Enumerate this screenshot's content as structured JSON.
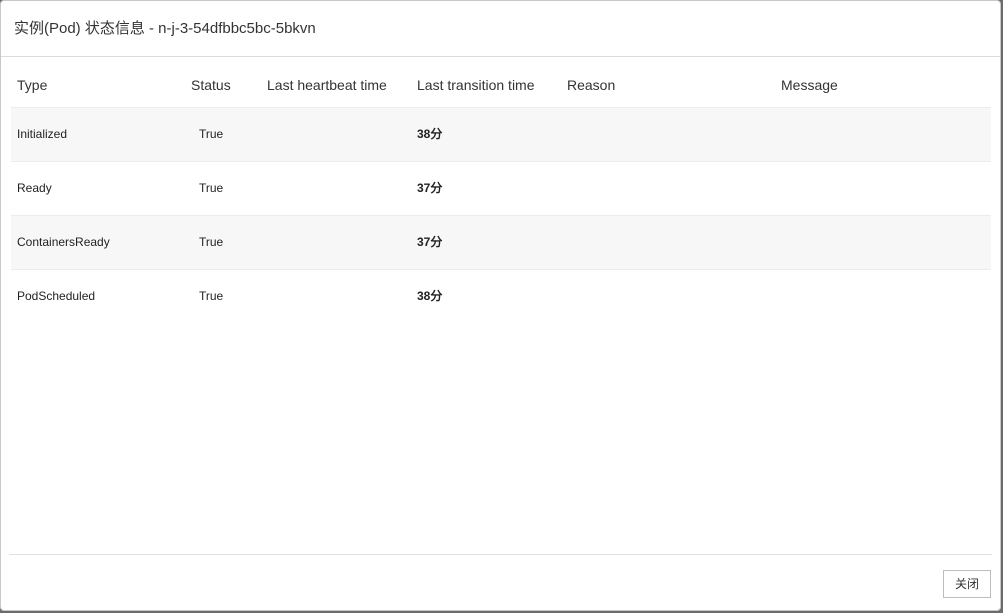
{
  "modal": {
    "title": "实例(Pod) 状态信息 - n-j-3-54dfbbc5bc-5bkvn",
    "close_label": "关闭"
  },
  "table": {
    "headers": {
      "type": "Type",
      "status": "Status",
      "last_heartbeat": "Last heartbeat time",
      "last_transition": "Last transition time",
      "reason": "Reason",
      "message": "Message"
    },
    "rows": [
      {
        "type": "Initialized",
        "status": "True",
        "last_heartbeat": "",
        "last_transition": "38分",
        "reason": "",
        "message": ""
      },
      {
        "type": "Ready",
        "status": "True",
        "last_heartbeat": "",
        "last_transition": "37分",
        "reason": "",
        "message": ""
      },
      {
        "type": "ContainersReady",
        "status": "True",
        "last_heartbeat": "",
        "last_transition": "37分",
        "reason": "",
        "message": ""
      },
      {
        "type": "PodScheduled",
        "status": "True",
        "last_heartbeat": "",
        "last_transition": "38分",
        "reason": "",
        "message": ""
      }
    ]
  }
}
